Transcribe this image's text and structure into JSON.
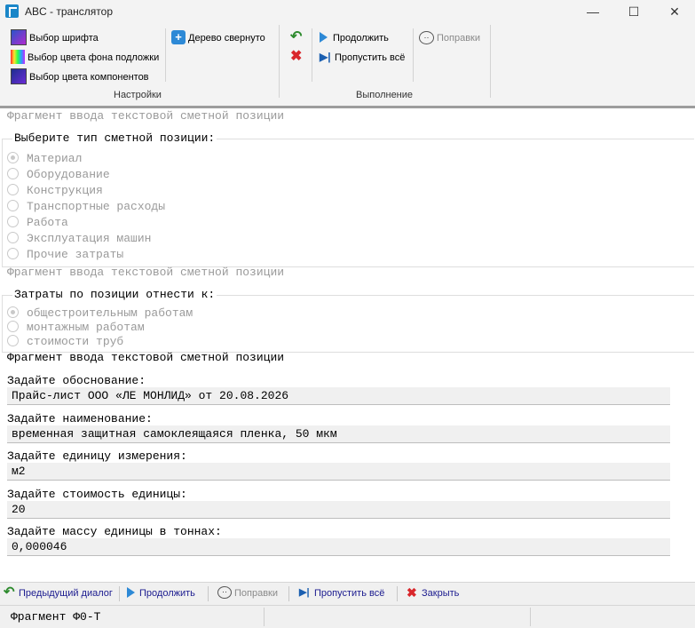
{
  "window": {
    "title": "ABC - транслятор",
    "min_glyph": "—",
    "max_glyph": "☐",
    "close_glyph": "✕"
  },
  "ribbon": {
    "font_btn": "Выбор шрифта",
    "bg_btn": "Выбор цвета фона подложки",
    "comp_btn": "Выбор цвета компонентов",
    "tree_btn": "Дерево свернуто",
    "continue_btn": "Продолжить",
    "skip_btn": "Пропустить всё",
    "fixes_btn": "Поправки",
    "group_settings": "Настройки",
    "group_execution": "Выполнение"
  },
  "section1": {
    "fragment_label": "Фрагмент ввода текстовой сметной позиции",
    "title": "Выберите тип сметной позиции:",
    "options": [
      "Материал",
      "Оборудование",
      "Конструкция",
      "Транспортные расходы",
      "Работа",
      "Эксплуатация машин",
      "Прочие затраты"
    ],
    "selected_index": 0
  },
  "section2": {
    "fragment_label": "Фрагмент ввода текстовой сметной позиции",
    "title": "Затраты по позиции отнести к:",
    "options": [
      "общестроительным работам",
      "монтажным работам",
      "стоимости труб"
    ],
    "selected_index": 0
  },
  "section3": {
    "fragment_label": "Фрагмент ввода текстовой сметной позиции",
    "fields": [
      {
        "label": "Задайте обоснование:",
        "value": "Прайс-лист ООО «ЛЕ МОНЛИД» от 20.08.2026"
      },
      {
        "label": "Задайте наименование:",
        "value": "временная защитная самоклеящаяся пленка, 50 мкм"
      },
      {
        "label": "Задайте единицу измерения:",
        "value": "м2"
      },
      {
        "label": "Задайте стоимость единицы:",
        "value": "20"
      },
      {
        "label": "Задайте массу единицы в тоннах:",
        "value": "0,000046"
      }
    ]
  },
  "bottombar": {
    "prev_btn": "Предыдущий диалог",
    "continue_btn": "Продолжить",
    "fixes_btn": "Поправки",
    "skip_btn": "Пропустить всё",
    "close_btn": "Закрыть"
  },
  "statusbar": {
    "text": "Фрагмент Ф0-Т"
  },
  "colors": {
    "ribbon_bg": "#f3f3f3",
    "field_bg": "#f0f0f0",
    "disabled_text": "#9a9a9a",
    "link_blue": "#1b1b8f",
    "accent_blue": "#2d89d6",
    "cancel_red": "#d9262b",
    "back_green": "#2e8b2e"
  }
}
